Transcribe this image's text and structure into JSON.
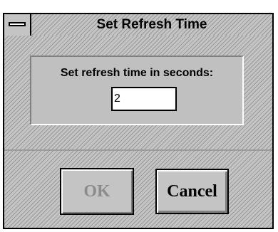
{
  "window": {
    "title": "Set Refresh Time"
  },
  "form": {
    "prompt": "Set refresh time in seconds:",
    "value": "2"
  },
  "buttons": {
    "ok_label": "OK",
    "ok_enabled": false,
    "cancel_label": "Cancel"
  },
  "colors": {
    "face": "#c4c4c4",
    "disabled_text": "#8c8c8c",
    "border": "#000000"
  },
  "icons": {
    "system_menu": "system-menu-icon"
  }
}
